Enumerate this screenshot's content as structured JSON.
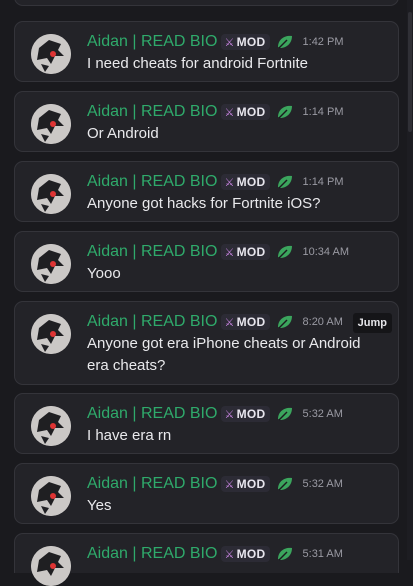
{
  "feed": {
    "colors": {
      "username": "#2faa6b",
      "background": "#1a1a1e",
      "card": "#232328",
      "text": "#e9e9ec",
      "timestamp": "#9a9aa3"
    },
    "badge_icon": "sword-icon",
    "status_icon": "leaf-icon",
    "messages": [
      {
        "username": "Aidan | READ BIO",
        "badge": "MOD",
        "time": "1:42 PM",
        "lines": [
          "I need cheats for android Fortnite"
        ]
      },
      {
        "username": "Aidan | READ BIO",
        "badge": "MOD",
        "time": "1:14 PM",
        "lines": [
          "Or Android"
        ]
      },
      {
        "username": "Aidan | READ BIO",
        "badge": "MOD",
        "time": "1:14 PM",
        "lines": [
          "Anyone got hacks for Fortnite iOS?"
        ]
      },
      {
        "username": "Aidan | READ BIO",
        "badge": "MOD",
        "time": "10:34 AM",
        "lines": [
          "Yooo"
        ]
      },
      {
        "username": "Aidan | READ BIO",
        "badge": "MOD",
        "time": "8:20 AM",
        "jump": "Jump",
        "lines": [
          "Anyone got era iPhone cheats or Android",
          "era cheats?"
        ]
      },
      {
        "username": "Aidan | READ BIO",
        "badge": "MOD",
        "time": "5:32 AM",
        "lines": [
          "I have era rn"
        ]
      },
      {
        "username": "Aidan | READ BIO",
        "badge": "MOD",
        "time": "5:32 AM",
        "lines": [
          "Yes"
        ]
      },
      {
        "username": "Aidan | READ BIO",
        "badge": "MOD",
        "time": "5:31 AM",
        "lines": []
      }
    ]
  }
}
